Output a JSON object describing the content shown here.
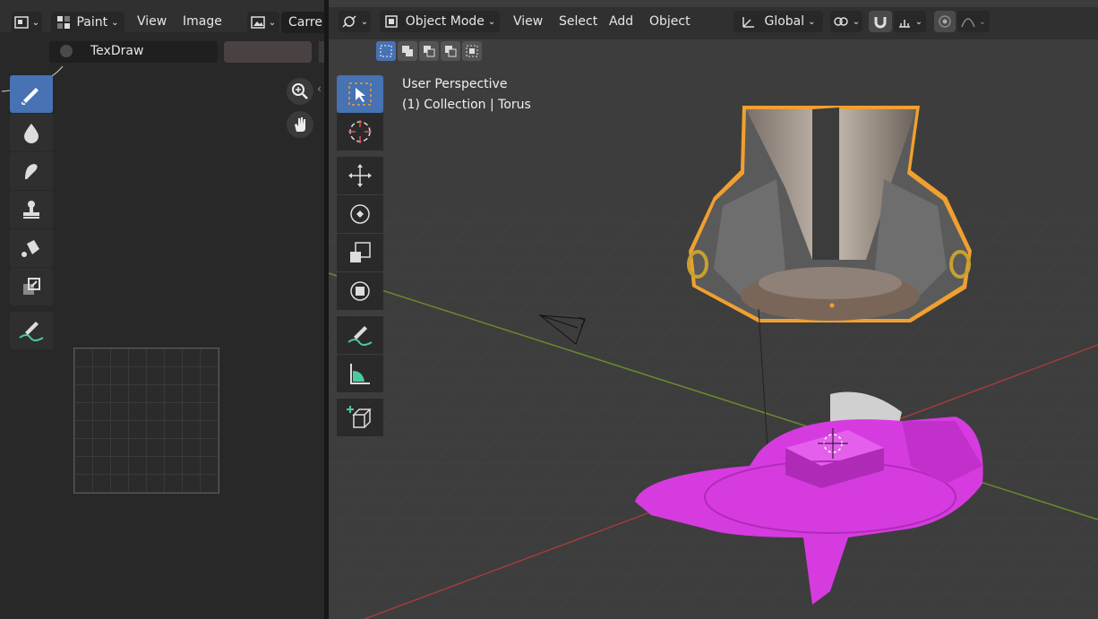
{
  "image_editor": {
    "header": {
      "mode_label": "Paint",
      "menus": [
        "View",
        "Image"
      ],
      "image_dropdown_label": "Carre"
    },
    "tool_settings": {
      "brush_name": "TexDraw"
    },
    "tools": [
      {
        "name": "draw",
        "icon": "brush-icon",
        "active": true
      },
      {
        "name": "soften",
        "icon": "droplet-icon",
        "active": false
      },
      {
        "name": "smear",
        "icon": "smear-icon",
        "active": false
      },
      {
        "name": "clone",
        "icon": "stamp-icon",
        "active": false
      },
      {
        "name": "fill",
        "icon": "fill-bucket-icon",
        "active": false
      },
      {
        "name": "mask",
        "icon": "mask-icon",
        "active": false
      },
      {
        "name": "annotate",
        "icon": "annotate-icon",
        "active": false
      }
    ]
  },
  "viewport": {
    "header": {
      "mode_label": "Object Mode",
      "menus": [
        "View",
        "Select",
        "Add",
        "Object"
      ],
      "orientation_label": "Global"
    },
    "overlay": {
      "perspective": "User Perspective",
      "collection": "(1) Collection | Torus"
    },
    "tools": [
      {
        "name": "select-box",
        "icon": "select-box-icon",
        "active": true
      },
      {
        "name": "cursor",
        "icon": "cursor-icon",
        "active": false
      },
      {
        "name": "move",
        "icon": "move-icon",
        "active": false
      },
      {
        "name": "rotate",
        "icon": "rotate-icon",
        "active": false
      },
      {
        "name": "scale",
        "icon": "scale-icon",
        "active": false
      },
      {
        "name": "transform",
        "icon": "transform-icon",
        "active": false
      },
      {
        "name": "annotate",
        "icon": "annotate-icon",
        "active": false
      },
      {
        "name": "measure",
        "icon": "measure-icon",
        "active": false
      },
      {
        "name": "add-cube",
        "icon": "add-cube-icon",
        "active": false
      }
    ]
  },
  "colors": {
    "accent": "#4772b3",
    "selection_outline": "#f0a030",
    "object_magenta": "#d63be0",
    "x_axis": "#a33b3b",
    "y_axis": "#6b8a2c"
  }
}
